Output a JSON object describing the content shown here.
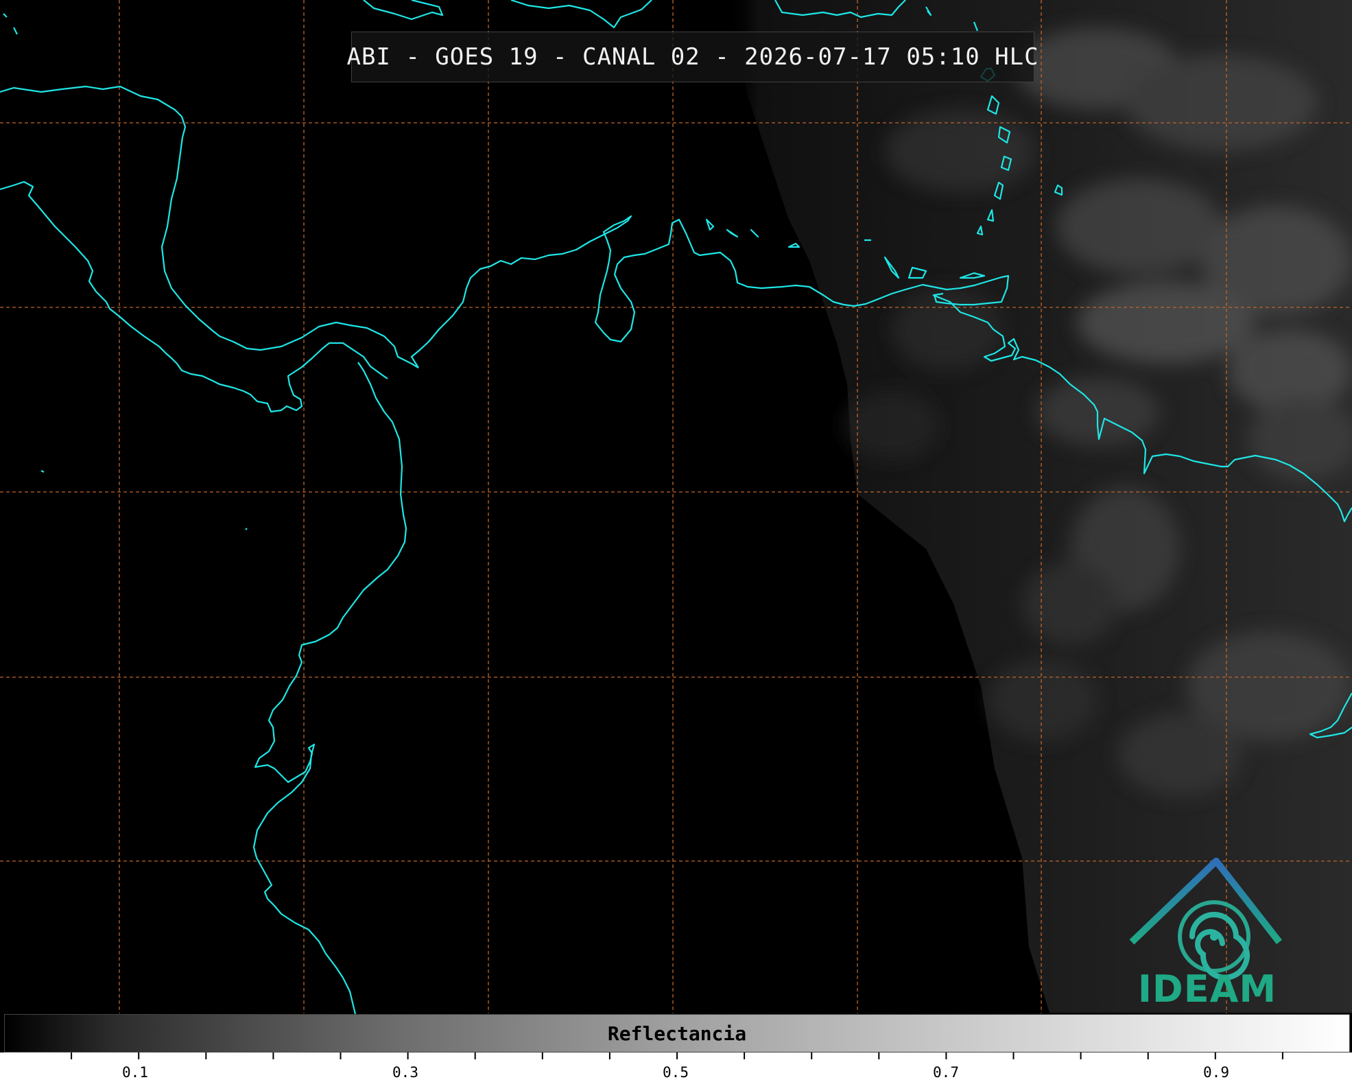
{
  "title": "ABI - GOES 19 - CANAL 02 - 2026-07-17 05:10 HLC",
  "colorbar": {
    "label": "Reflectancia",
    "tick_labels": [
      "0.1",
      "0.3",
      "0.5",
      "0.7",
      "0.9"
    ],
    "range": [
      0.0,
      1.0
    ]
  },
  "logo": {
    "text": "IDEAM"
  },
  "colors": {
    "coastline": "#1fe6e6",
    "graticule": "#c0652a",
    "logo_blue": "#2f6fb8",
    "logo_green": "#1fa985"
  },
  "icons": [
    "ideam-logo-icon"
  ]
}
